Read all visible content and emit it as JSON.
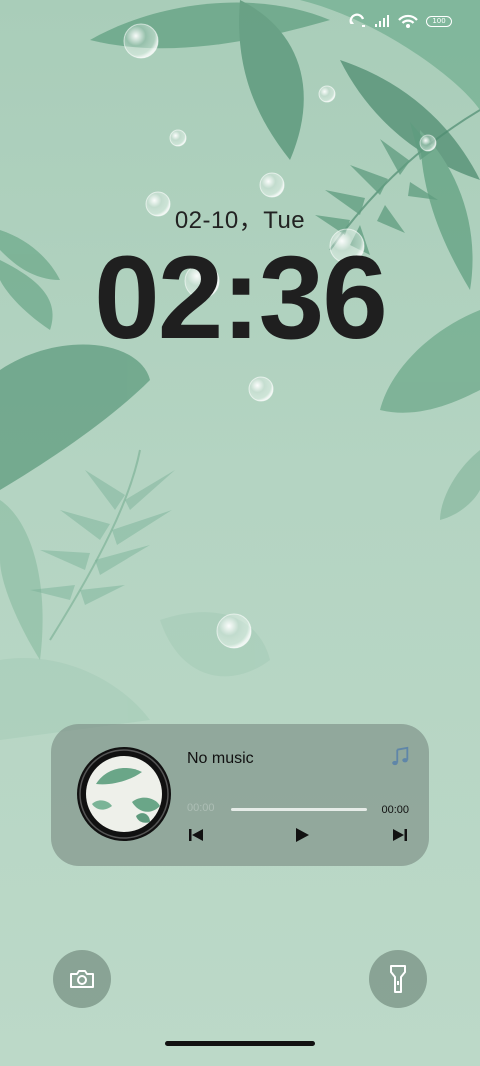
{
  "status_bar": {
    "icons": [
      "sync-icon",
      "signal-icon",
      "wifi-icon",
      "battery-icon"
    ],
    "battery_level": "100"
  },
  "lockscreen": {
    "date": "02-10，Tue",
    "time": "02:36"
  },
  "music_player": {
    "track_title": "No music",
    "elapsed": "00:00",
    "duration": "00:00",
    "progress": 0,
    "controls": [
      "previous-icon",
      "play-icon",
      "next-icon"
    ],
    "note_icon": "music-note-icon"
  },
  "shortcuts": {
    "left": "camera-icon",
    "right": "flashlight-icon"
  },
  "colors": {
    "background": "#b1d2bf",
    "leaf": "#6fa98c",
    "card": "#8a9c93",
    "note_accent": "#5f86a8"
  }
}
